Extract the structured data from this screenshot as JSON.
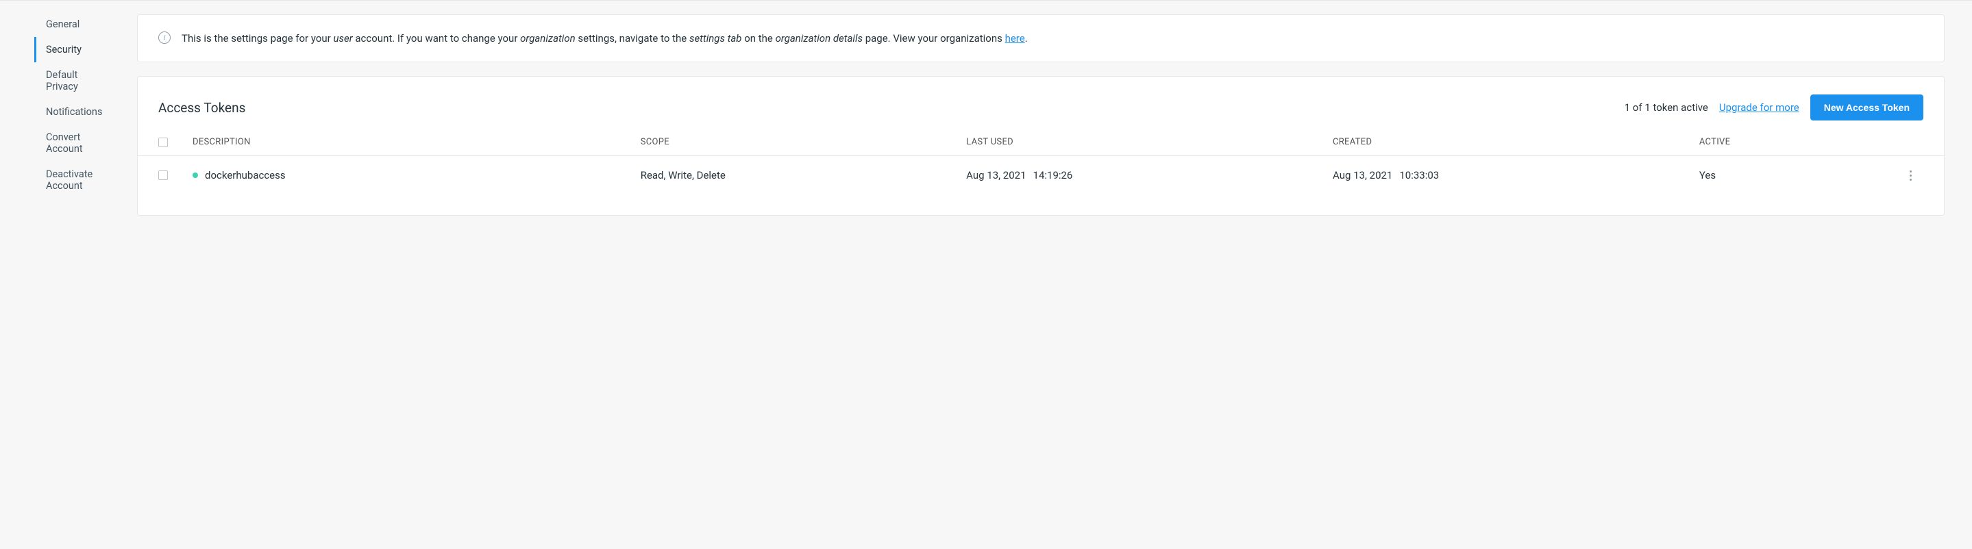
{
  "sidebar": {
    "items": [
      {
        "label": "General"
      },
      {
        "label": "Security"
      },
      {
        "label": "Default Privacy"
      },
      {
        "label": "Notifications"
      },
      {
        "label": "Convert Account"
      },
      {
        "label": "Deactivate Account"
      }
    ],
    "active_index": 1
  },
  "infobox": {
    "part1": "This is the settings page for your ",
    "em1": "user",
    "part2": " account. If you want to change your ",
    "em2": "organization",
    "part3": " settings, navigate to the ",
    "em3": "settings tab",
    "part4": " on the ",
    "em4": "organization details",
    "part5": " page. View your organizations ",
    "link": "here",
    "part6": "."
  },
  "tokens": {
    "title": "Access Tokens",
    "status": "1 of 1 token active",
    "upgrade": "Upgrade for more",
    "new_btn": "New Access Token",
    "headers": {
      "description": "DESCRIPTION",
      "scope": "SCOPE",
      "last_used": "LAST USED",
      "created": "CREATED",
      "active": "ACTIVE"
    },
    "rows": [
      {
        "description": "dockerhubaccess",
        "scope": "Read, Write, Delete",
        "last_used_date": "Aug 13, 2021",
        "last_used_time": "14:19:26",
        "created_date": "Aug 13, 2021",
        "created_time": "10:33:03",
        "active": "Yes"
      }
    ]
  }
}
